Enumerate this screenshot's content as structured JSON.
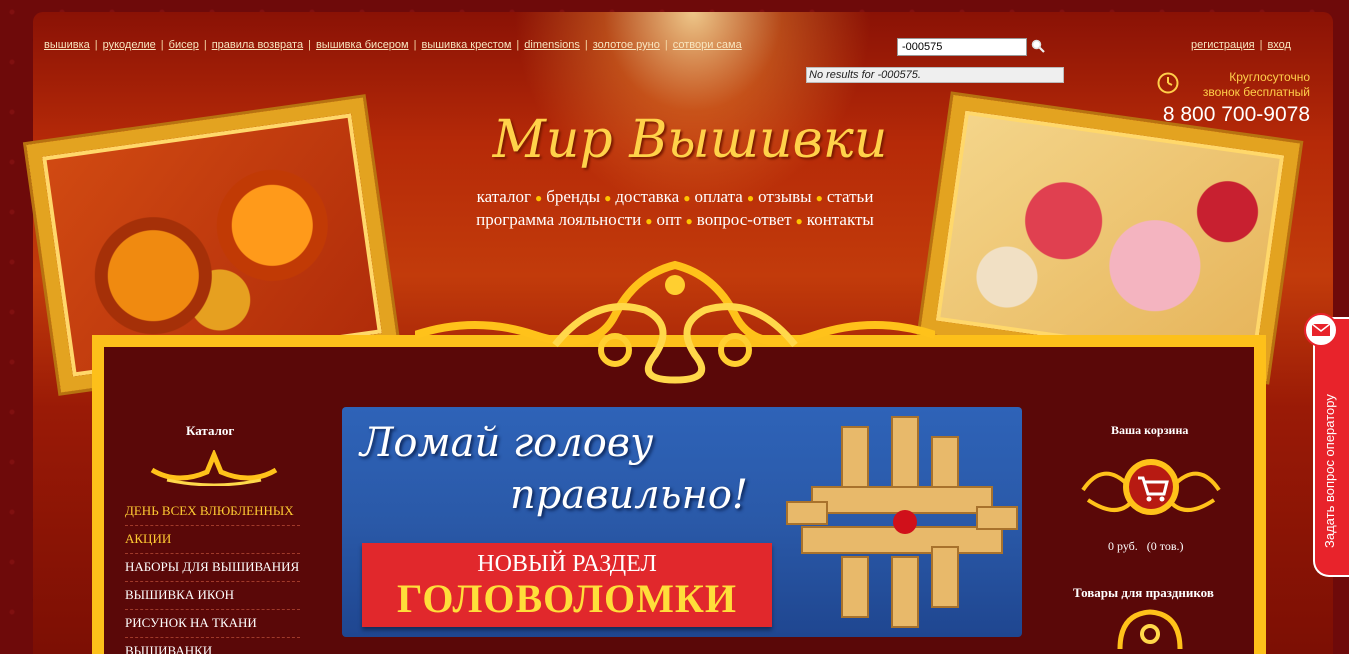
{
  "toplinks": [
    "вышивка",
    "рукоделие",
    "бисер",
    "правила возврата",
    "вышивка бисером",
    "вышивка крестом",
    "dimensions",
    "золотое руно",
    "сотвори сама"
  ],
  "search": {
    "value": "-000575",
    "no_results": "No results for -000575."
  },
  "auth": {
    "register": "регистрация",
    "login": "вход"
  },
  "contact": {
    "note_line1": "Круглосуточно",
    "note_line2": "звонок бесплатный",
    "phone": "8 800 700-9078"
  },
  "logo": "Мир Вышивки",
  "mainnav": {
    "row1": [
      "каталог",
      "бренды",
      "доставка",
      "оплата",
      "отзывы",
      "статьи"
    ],
    "row2": [
      "программа лояльности",
      "опт",
      "вопрос-ответ",
      "контакты"
    ]
  },
  "catalog": {
    "title": "Каталог",
    "items": [
      "День всех влюбленных",
      "Акции",
      "Наборы для вышивания",
      "Вышивка икон",
      "Рисунок на ткани",
      "Вышиванки"
    ]
  },
  "banner": {
    "headline_line1": "Ломай голову",
    "headline_line2": "правильно!",
    "ribbon_line1": "НОВЫЙ РАЗДЕЛ",
    "ribbon_line2": "ГОЛОВОЛОМКИ"
  },
  "cart": {
    "title": "Ваша корзина",
    "sum": "0 руб.",
    "count": "(0 тов.)"
  },
  "holiday_title": "Товары для праздников",
  "operator_label": "Задать вопрос оператору",
  "colors": {
    "gold": "#fdc01a",
    "dark_red": "#6b0a0a",
    "accent_red": "#e1282c",
    "banner_blue": "#2e63b8"
  }
}
